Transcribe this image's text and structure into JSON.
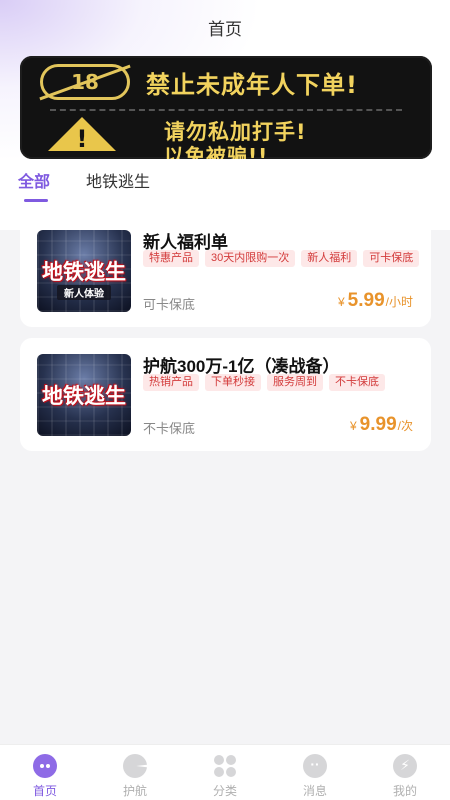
{
  "header": {
    "title": "首页"
  },
  "banner": {
    "badge": "18",
    "line1": "禁止未成年人下单!",
    "line2": "请勿私加打手!",
    "line3": "以免被骗!!",
    "accent_color": "#f2d35e"
  },
  "tabs": [
    {
      "label": "全部",
      "active": true
    },
    {
      "label": "地铁逃生",
      "active": false
    }
  ],
  "products": [
    {
      "thumb_title": "地铁逃生",
      "thumb_sub": "新人体验",
      "title": "新人福利单",
      "tags": [
        "特惠产品",
        "30天内限购一次",
        "新人福利",
        "可卡保底"
      ],
      "desc": "可卡保底",
      "currency": "¥",
      "price": "5.99",
      "unit": "/小时"
    },
    {
      "thumb_title": "地铁逃生",
      "thumb_sub": "",
      "title": "护航300万-1亿（凑战备）",
      "tags": [
        "热销产品",
        "下单秒接",
        "服务周到",
        "不卡保底"
      ],
      "desc": "不卡保底",
      "currency": "¥",
      "price": "9.99",
      "unit": "/次"
    }
  ],
  "tabbar": [
    {
      "label": "首页",
      "icon": "game-controller-icon",
      "active": true
    },
    {
      "label": "护航",
      "icon": "shield-icon",
      "active": false
    },
    {
      "label": "分类",
      "icon": "category-grid-icon",
      "active": false
    },
    {
      "label": "消息",
      "icon": "message-icon",
      "active": false
    },
    {
      "label": "我的",
      "icon": "profile-icon",
      "active": false
    }
  ],
  "colors": {
    "primary": "#7f5ae0",
    "price": "#e8932b",
    "tag_text": "#d33b3b",
    "tag_bg": "#fde8e8"
  }
}
